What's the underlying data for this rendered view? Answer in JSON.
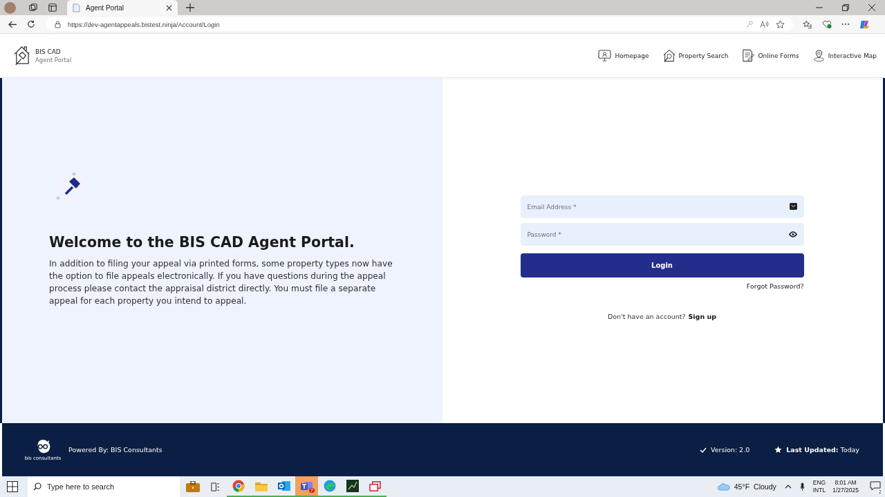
{
  "browser": {
    "tabs": [
      {
        "title": "Agent Portal",
        "selected": true
      }
    ],
    "url": "https://dev-agentappeals.bistest.ninja/Account/Login"
  },
  "header": {
    "brand": "BIS CAD",
    "subtitle": "Agent Portal",
    "nav": [
      {
        "kind": "monitor",
        "label": "Homepage"
      },
      {
        "kind": "house-search",
        "label": "Property Search"
      },
      {
        "kind": "form",
        "label": "Online Forms"
      },
      {
        "kind": "map-pin",
        "label": "Interactive Map"
      }
    ]
  },
  "welcome": {
    "heading": "Welcome to the BIS CAD Agent Portal.",
    "text": "In addition to filing your appeal via printed forms, some property types now have the option to file appeals electronically. If you have questions during the appeal process please contact the appraisal district directly. You must file a separate appeal for each property you intend to appeal."
  },
  "login": {
    "email": {
      "placeholder": "Email Address *"
    },
    "password": {
      "placeholder": "Password *"
    },
    "submit": "Login",
    "forgot": "Forgot Password?",
    "signup_prompt": "Don't have an account?",
    "signup_link": "Sign up"
  },
  "footer": {
    "logo_text": "bis consultants",
    "powered_by": "Powered By: BIS Consultants",
    "version": "Version: 2.0",
    "updated": "**Last Updated:** Today"
  },
  "taskbar": {
    "search": {
      "placeholder": "Type here to search"
    },
    "apps": [
      {
        "kind": "briefcase",
        "running": false,
        "selected": false
      },
      {
        "kind": "task-view",
        "running": false,
        "selected": false
      },
      {
        "kind": "chrome",
        "running": true,
        "selected": false
      },
      {
        "kind": "folder",
        "running": true,
        "selected": false
      },
      {
        "kind": "outlook",
        "running": true,
        "selected": false
      },
      {
        "kind": "teams",
        "running": true,
        "selected": true,
        "badge": "7"
      },
      {
        "kind": "edge",
        "running": true,
        "selected": false
      },
      {
        "kind": "terminal",
        "running": true,
        "selected": false
      },
      {
        "kind": "windows",
        "running": true,
        "selected": false
      }
    ],
    "weather": {
      "temp": "45°F",
      "condition": "Cloudy"
    },
    "language": "ENG",
    "layout": "INTL",
    "time": "8:01 AM",
    "date": "1/27/2025",
    "notifications": "2"
  }
}
